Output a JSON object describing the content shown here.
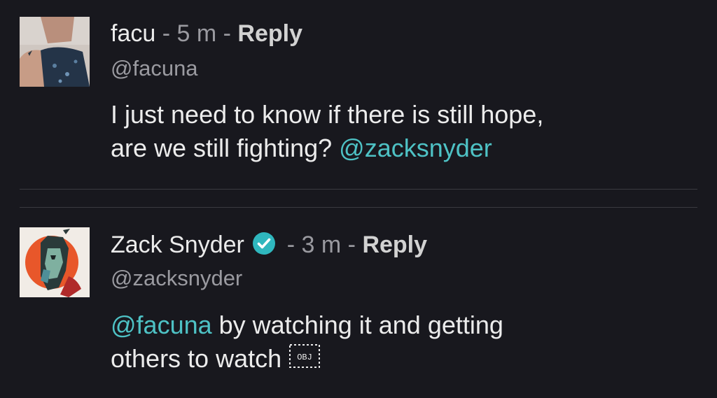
{
  "comments": [
    {
      "name": "facu",
      "sep1": " - ",
      "time": "5 m",
      "sep2": " - ",
      "reply_label": "Reply",
      "handle": "@facuna",
      "text_line1": "I just need to know if there is still hope,",
      "text_line2": "are we still fighting? ",
      "mention": "@zacksnyder"
    },
    {
      "name": "Zack Snyder",
      "verified": true,
      "sep1": " - ",
      "time": "3 m",
      "sep2": " - ",
      "reply_label": "Reply",
      "handle": "@zacksnyder",
      "mention": "@facuna",
      "text_line1_rest": " by watching it and getting",
      "text_line2": "others to watch",
      "trailing_glyph": "OBJ"
    }
  ],
  "colors": {
    "background": "#18181e",
    "mention": "#4ec2c5",
    "verified": "#2fb7be"
  }
}
